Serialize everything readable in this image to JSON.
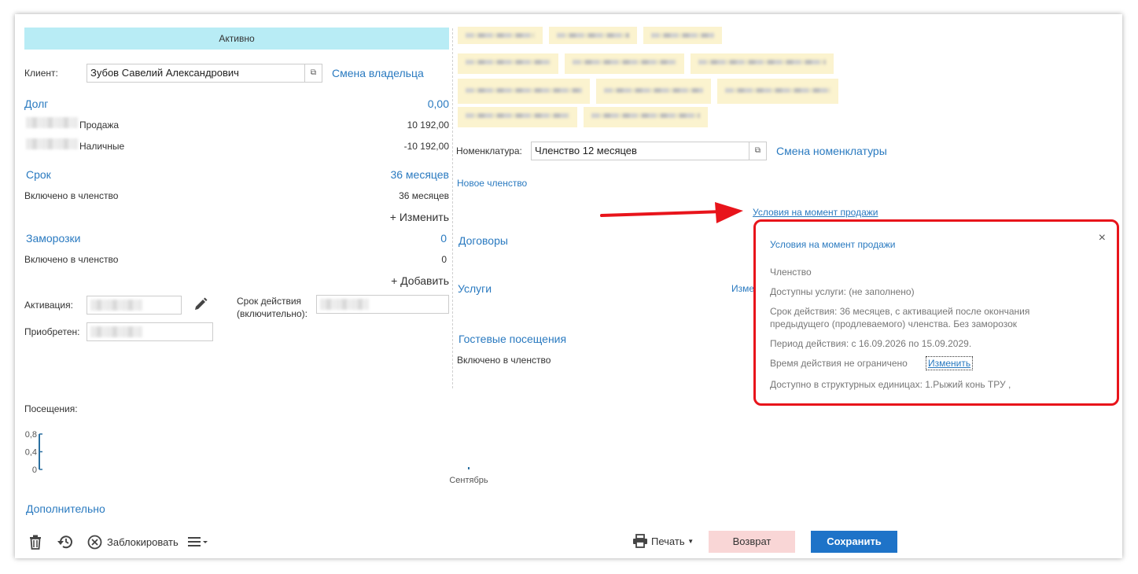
{
  "status": "Активно",
  "client": {
    "label": "Клиент:",
    "value": "Зубов Савелий Александрович",
    "change_owner": "Смена владельца"
  },
  "debt": {
    "title": "Долг",
    "total": "0,00",
    "rows": [
      {
        "label": "Продажа",
        "amount": "10 192,00"
      },
      {
        "label": "Наличные",
        "amount": "-10 192,00"
      }
    ]
  },
  "term": {
    "title": "Срок",
    "total": "36 месяцев",
    "included_label": "Включено в членство",
    "included_value": "36 месяцев",
    "change": "+ Изменить"
  },
  "freezes": {
    "title": "Заморозки",
    "total": "0",
    "included_label": "Включено в членство",
    "included_value": "0",
    "add": "+ Добавить"
  },
  "activation": {
    "label": "Активация:",
    "validity_label_1": "Срок действия",
    "validity_label_2": "(включительно):",
    "acquired_label": "Приобретен:"
  },
  "nomenclature": {
    "label": "Номенклатура:",
    "value": "Членство 12 месяцев",
    "change": "Смена номенклатуры"
  },
  "new_membership": "Новое членство",
  "conditions_link": "Условия на момент продажи",
  "contracts": "Договоры",
  "services": "Услуги",
  "services_change_partial": "Изме",
  "guest_visits": {
    "title": "Гостевые посещения",
    "included_label": "Включено в членство"
  },
  "visits": {
    "label": "Посещения:",
    "month": "Сентябрь"
  },
  "chart_data": {
    "type": "bar",
    "categories": [
      "Сентябрь"
    ],
    "values": [
      0
    ],
    "yticks": [
      "0,8",
      "0,4",
      "0"
    ],
    "ylim": [
      0,
      0.8
    ]
  },
  "additional": "Дополнительно",
  "toolbar": {
    "block": "Заблокировать",
    "print": "Печать",
    "return": "Возврат",
    "save": "Сохранить"
  },
  "popup": {
    "title": "Условия на момент продажи",
    "close": "×",
    "type": "Членство",
    "services": "Доступны услуги: (не заполнено)",
    "term_line1": "Срок действия: 36 месяцев, с активацией после окончания",
    "term_line2": "предыдущего (продлеваемого) членства. Без заморозок",
    "period": "Период действия: с 16.09.2026 по 15.09.2029.",
    "time": "Время действия не ограничено",
    "time_change": "Изменить",
    "units": "Доступно в структурных единицах: 1.Рыжий конь ТРУ ,"
  },
  "colors": {
    "accent": "#2a7ac0",
    "status_bg": "#b8ecf5",
    "save_bg": "#1e73c8",
    "return_bg": "#f9d6d6",
    "highlight": "#e8141b"
  }
}
